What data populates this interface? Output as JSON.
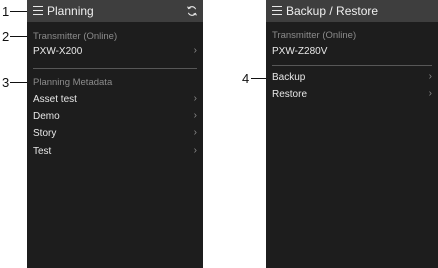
{
  "callouts": [
    "1",
    "2",
    "3",
    "4"
  ],
  "left_screen": {
    "title": "Planning",
    "icons": {
      "menu": "hamburger-menu-icon",
      "refresh": "refresh-icon"
    },
    "transmitter_label": "Transmitter (Online)",
    "transmitter_device": "PXW-X200",
    "metadata_label": "Planning Metadata",
    "items": [
      {
        "label": "Asset test"
      },
      {
        "label": "Demo"
      },
      {
        "label": "Story"
      },
      {
        "label": "Test"
      }
    ]
  },
  "right_screen": {
    "title": "Backup / Restore",
    "icons": {
      "menu": "hamburger-menu-icon"
    },
    "transmitter_label": "Transmitter (Online)",
    "transmitter_device": "PXW-Z280V",
    "items": [
      {
        "label": "Backup"
      },
      {
        "label": "Restore"
      }
    ]
  },
  "colors": {
    "screen_bg": "#1d1d1d",
    "titlebar_bg": "#3e3e3e",
    "section_text": "#8c8c8c",
    "item_text": "#e8e8e8"
  }
}
